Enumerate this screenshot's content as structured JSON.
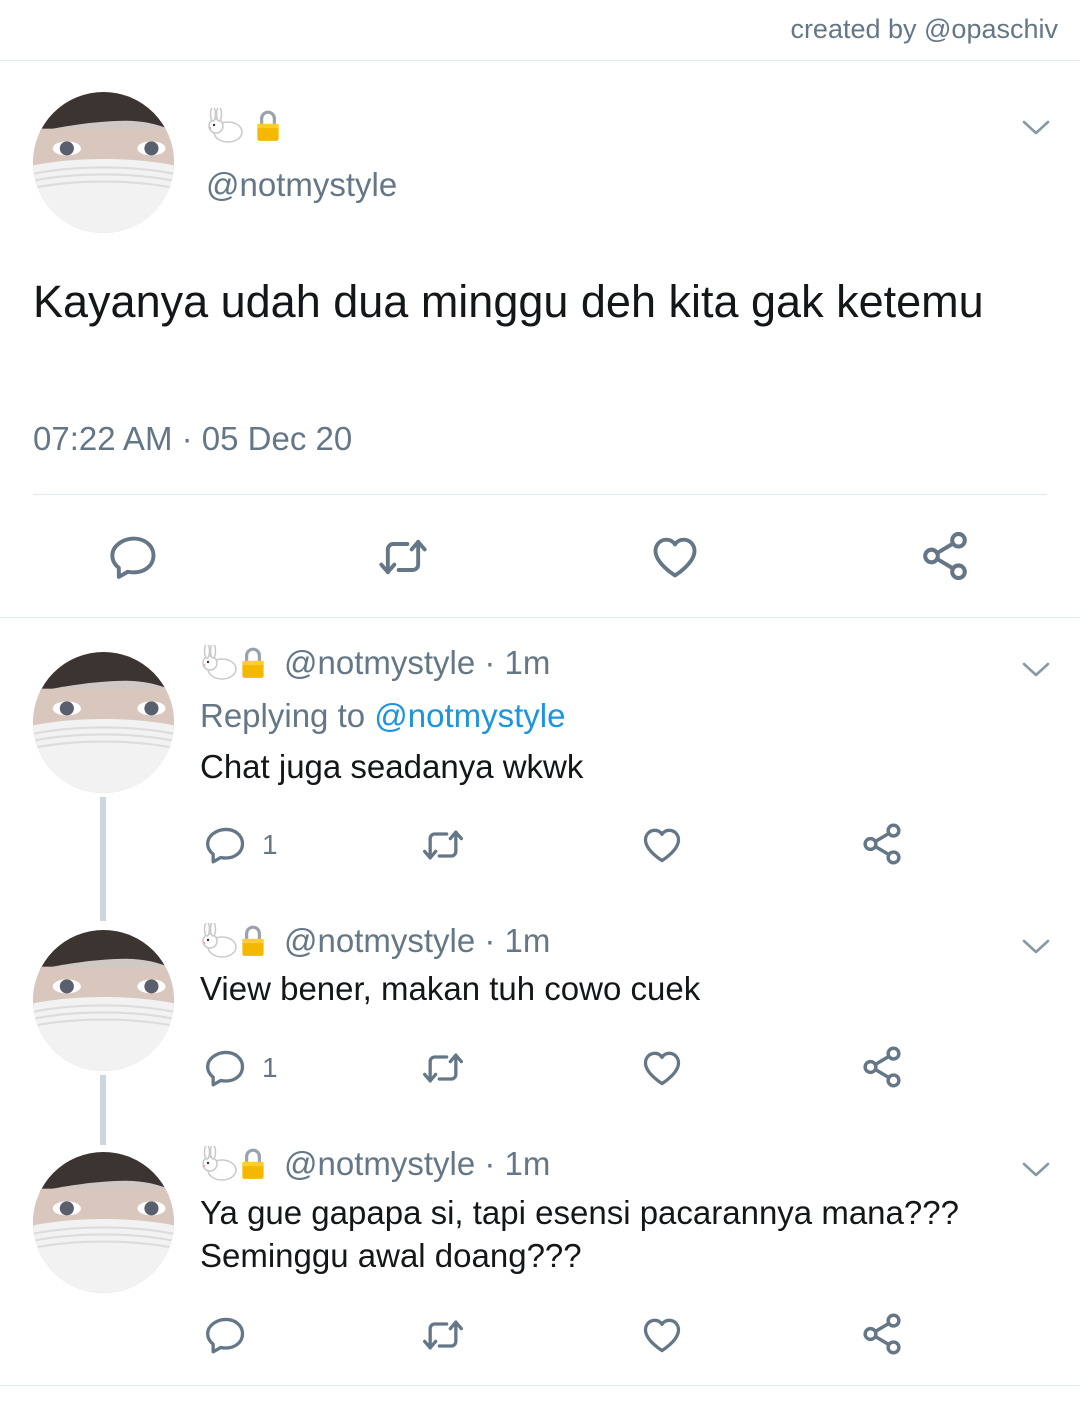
{
  "credit": "created by @opaschiv",
  "tweet": {
    "name_emoji": "🐇🔒",
    "handle": "@notmystyle",
    "text": "Kayanya udah dua minggu deh kita gak ketemu",
    "timestamp": "07:22 AM · 05 Dec 20",
    "actions": [
      "reply-icon",
      "retweet-icon",
      "like-icon",
      "share-icon"
    ]
  },
  "replies": [
    {
      "name_emoji": "🐇🔒",
      "handle_time": "@notmystyle · 1m",
      "replying_prefix": "Replying to ",
      "replying_handle": "@notmystyle",
      "text": "Chat juga seadanya wkwk",
      "reply_count": "1"
    },
    {
      "name_emoji": "🐇🔒",
      "handle_time": "@notmystyle · 1m",
      "text": "View bener, makan tuh cowo cuek",
      "reply_count": "1"
    },
    {
      "name_emoji": "🐇🔒",
      "handle_time": "@notmystyle · 1m",
      "text": "Ya gue gapapa si, tapi esensi pacarannya mana??? Seminggu awal doang???",
      "reply_count": ""
    }
  ],
  "colors": {
    "text_primary": "#14171a",
    "text_secondary": "#657786",
    "link": "#1b95e0",
    "divider": "#e1e8ed",
    "thread_line": "#ccd6dd"
  }
}
